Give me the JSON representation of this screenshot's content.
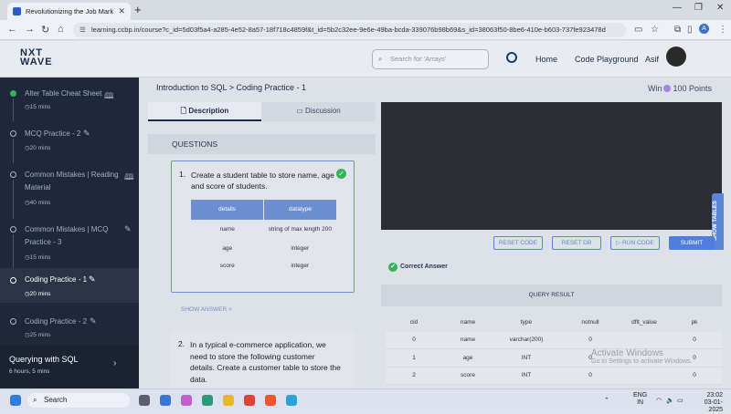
{
  "browser": {
    "tab_title": "Revolutionizing the Job Market",
    "url": "learning.ccbp.in/course?c_id=5d03f5a4-a285-4e52-8a57-18f718c4859f&t_id=5b2c32ee-9e6e-49ba-bcda-339076b98b69&s_id=38063f50-8be6-410e-b603-737fe923478d",
    "profile_initial": "A"
  },
  "header": {
    "logo_line1": "NXT",
    "logo_line2": "WAVE",
    "search_placeholder": "Search for 'Arrays'",
    "home": "Home",
    "code_playground": "Code Playground",
    "user": "Asif"
  },
  "sidebar": {
    "items": [
      {
        "label": "Alter Table Cheat Sheet",
        "meta": "15 mins"
      },
      {
        "label": "MCQ Practice - 2",
        "meta": "20 mins"
      },
      {
        "label": "Common Mistakes | Reading Material",
        "meta": "40 mins"
      },
      {
        "label": "Common Mistakes | MCQ Practice - 3",
        "meta": "15 mins"
      },
      {
        "label": "Coding Practice - 1",
        "meta": "20 mins"
      },
      {
        "label": "Coding Practice - 2",
        "meta": "25 mins"
      }
    ],
    "bottom_title": "Querying with SQL",
    "bottom_meta": "6 hours, 5 mins"
  },
  "main": {
    "breadcrumb": "Introduction to SQL > Coding Practice - 1",
    "win_prefix": "Win",
    "win_points": "100 Points",
    "tab_description": "Description",
    "tab_discussion": "Discussion",
    "questions_title": "QUESTIONS",
    "q1": {
      "num": "1.",
      "text": "Create a  student  table to store name, age and score of students.",
      "table_headers": [
        "details",
        "datatype"
      ],
      "table_rows": [
        [
          "name",
          "string of max length 200"
        ],
        [
          "age",
          "integer"
        ],
        [
          "score",
          "integer"
        ]
      ]
    },
    "show_answer": "SHOW ANSWER >",
    "q2": {
      "num": "2.",
      "text": "In a typical e-commerce application, we need to store the following customer details. Create a  customer  table to store the data."
    },
    "show_tables": "SHOW TABLES",
    "buttons": {
      "reset_code": "RESET CODE",
      "reset_db": "RESET DB",
      "run_code": "▷ RUN CODE",
      "submit": "SUBMIT"
    },
    "correct_answer": "Correct Answer",
    "query_result_title": "QUERY RESULT",
    "result_headers": [
      "cid",
      "name",
      "type",
      "notnull",
      "dflt_value",
      "pk"
    ],
    "result_rows": [
      [
        "0",
        "name",
        "varchar(200)",
        "0",
        "",
        "0"
      ],
      [
        "1",
        "age",
        "INT",
        "0",
        "",
        "0"
      ],
      [
        "2",
        "score",
        "INT",
        "0",
        "",
        "0"
      ]
    ],
    "watermark_title": "Activate Windows",
    "watermark_sub": "Go to Settings to activate Windows."
  },
  "taskbar": {
    "search": "Search",
    "lang_top": "ENG",
    "lang_bottom": "IN",
    "time": "23:02",
    "date": "03-01-2025"
  }
}
